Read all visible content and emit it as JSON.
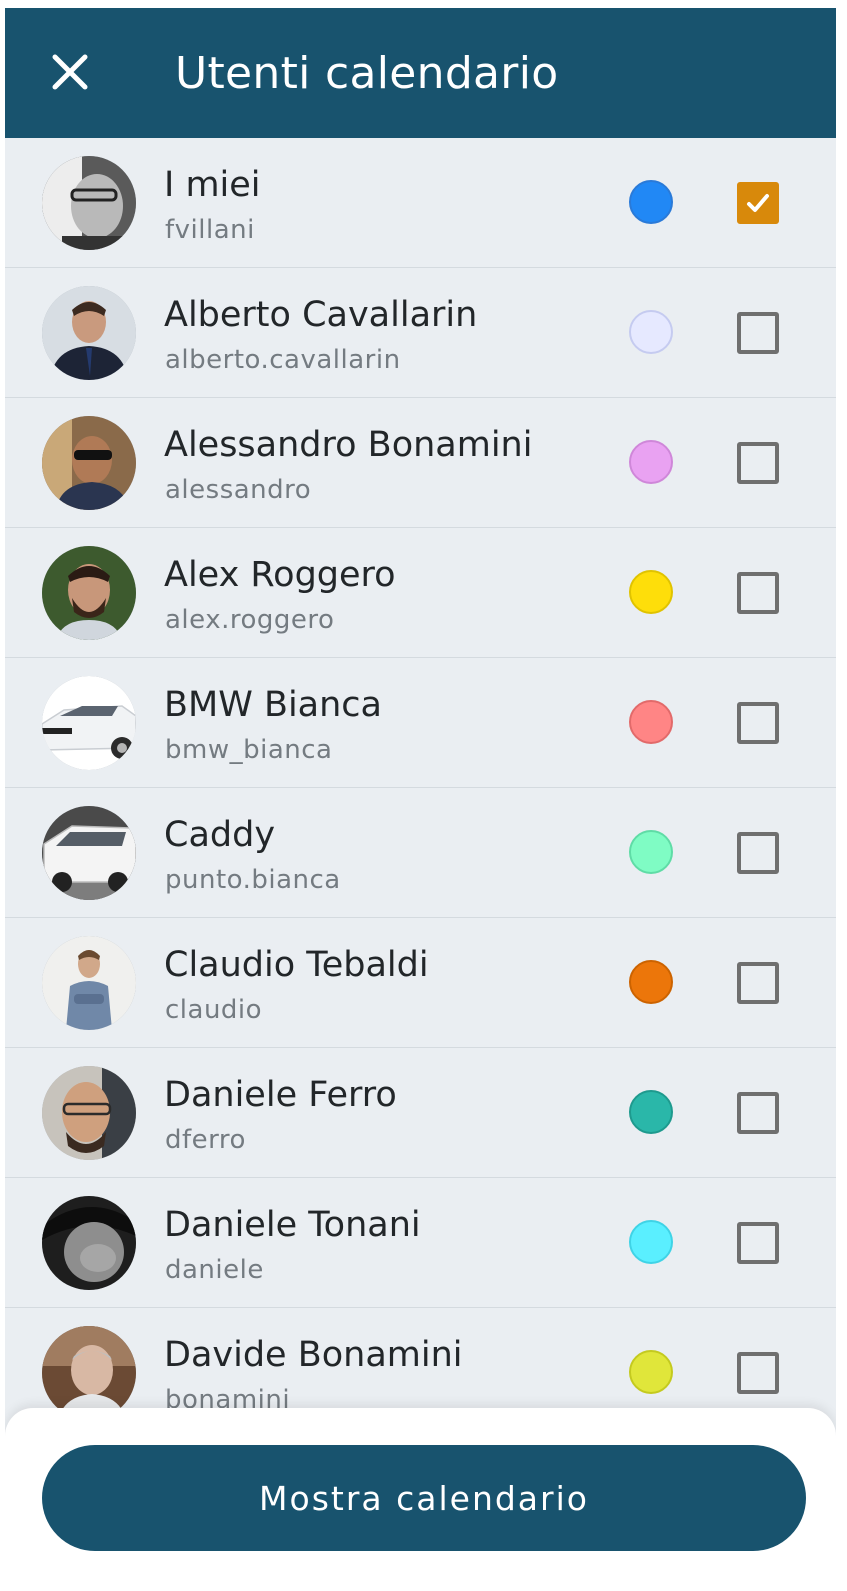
{
  "header": {
    "title": "Utenti calendario",
    "close_icon": "close-icon"
  },
  "users": [
    {
      "name": "I miei",
      "username": "fvillani",
      "color": "#2188f5",
      "checked": true
    },
    {
      "name": "Alberto Cavallarin",
      "username": "alberto.cavallarin",
      "color": "#e6e9ff",
      "checked": false
    },
    {
      "name": "Alessandro Bonamini",
      "username": "alessandro",
      "color": "#e9a2f2",
      "checked": false
    },
    {
      "name": "Alex Roggero",
      "username": "alex.roggero",
      "color": "#fede0a",
      "checked": false
    },
    {
      "name": "BMW Bianca",
      "username": "bmw_bianca",
      "color": "#ff8585",
      "checked": false
    },
    {
      "name": "Caddy",
      "username": "punto.bianca",
      "color": "#7ffcc4",
      "checked": false
    },
    {
      "name": "Claudio Tebaldi",
      "username": "claudio",
      "color": "#ec760a",
      "checked": false
    },
    {
      "name": "Daniele Ferro",
      "username": "dferro",
      "color": "#2ab7a9",
      "checked": false
    },
    {
      "name": "Daniele Tonani",
      "username": "daniele",
      "color": "#5aefff",
      "checked": false
    },
    {
      "name": "Davide Bonamini",
      "username": "bonamini",
      "color": "#e0e63a",
      "checked": false
    }
  ],
  "footer": {
    "button_label": "Mostra calendario"
  },
  "colors": {
    "header": "#18536e",
    "checkbox_checked": "#d8890b",
    "background": "#eaeef2"
  }
}
